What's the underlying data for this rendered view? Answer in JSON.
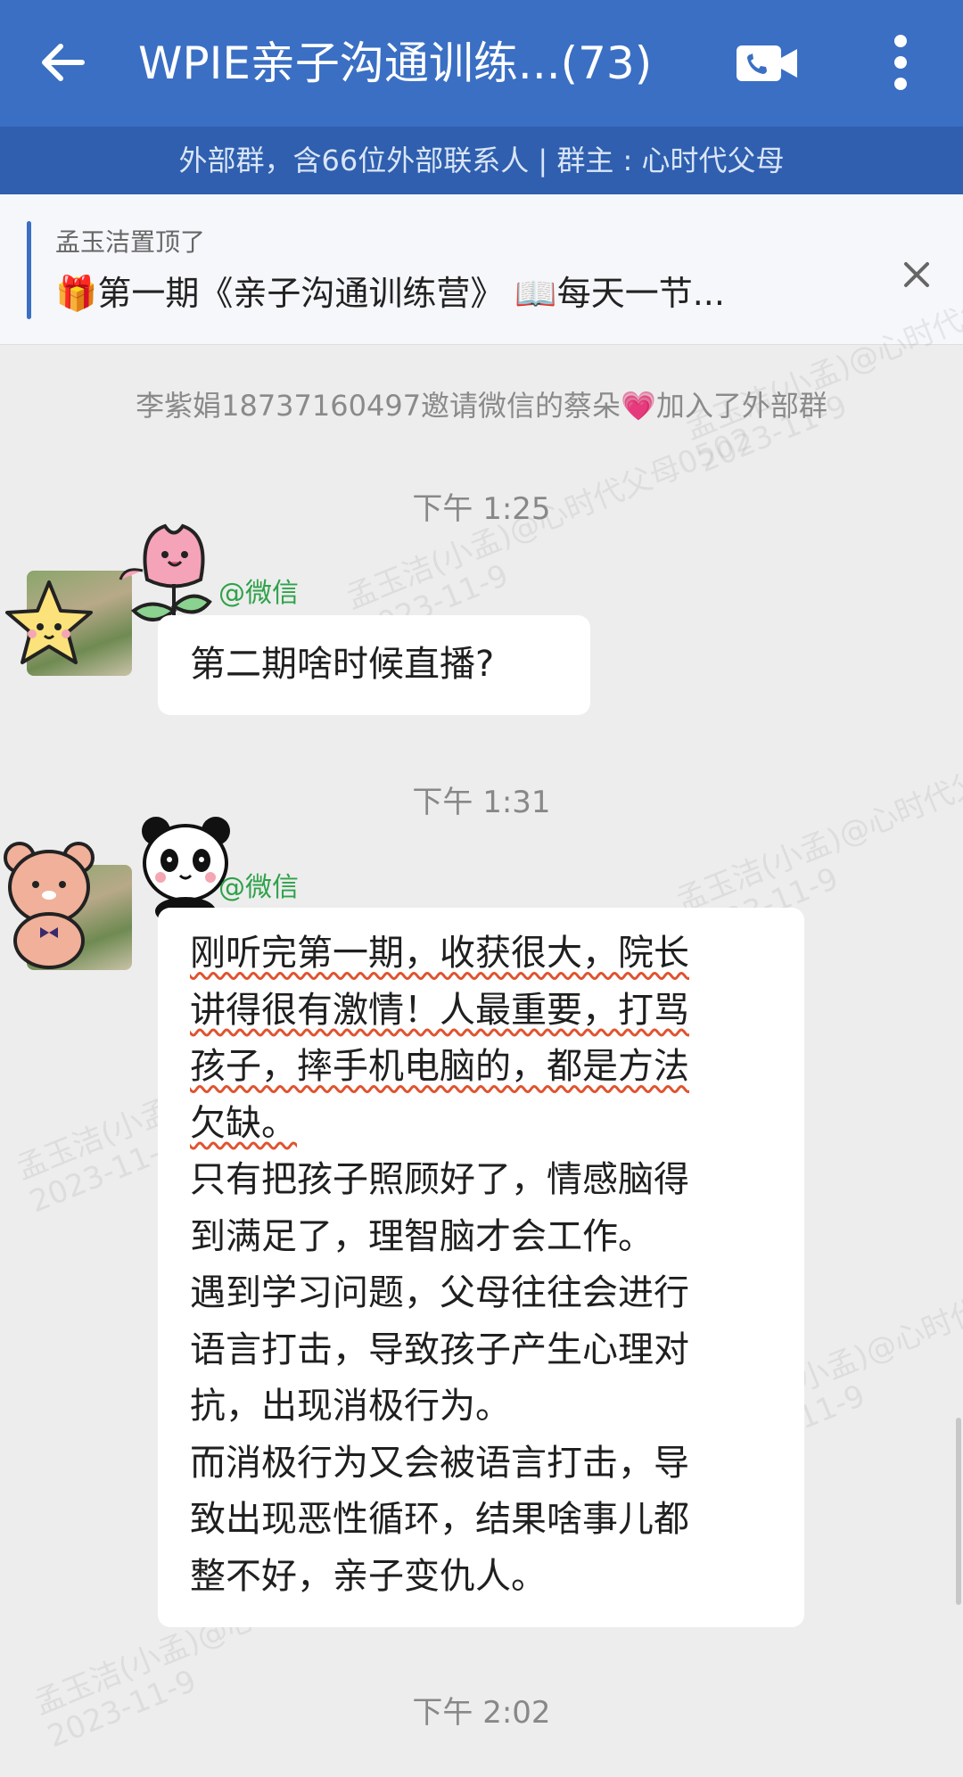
{
  "header": {
    "title": "WPIE亲子沟通训练...(73)",
    "subtitle": "外部群，含66位外部联系人 | 群主 : 心时代父母"
  },
  "pinned": {
    "by": "孟玉洁置顶了",
    "content": "🎁第一期《亲子沟通训练营》 📖每天一节..."
  },
  "messages": {
    "system": "李紫娟18737160497邀请微信的蔡朵💗加入了外部群",
    "time1": "下午 1:25",
    "msg1_sender": "@微信",
    "msg1_text": "第二期啥时候直播?",
    "time2": "下午 1:31",
    "msg2_sender": "@微信",
    "msg2_lines": [
      "刚听完第一期，收获很大，院长",
      "讲得很有激情！人最重要，打骂",
      "孩子，摔手机电脑的，都是方法",
      "欠缺。",
      "只有把孩子照顾好了，情感脑得",
      "到满足了，理智脑才会工作。",
      "遇到学习问题，父母往往会进行",
      "语言打击，导致孩子产生心理对",
      "抗，出现消极行为。",
      "而消极行为又会被语言打击，导",
      "致出现恶性循环，结果啥事儿都",
      "整不好，亲子变仇人。"
    ],
    "time3": "下午 2:02"
  },
  "watermarks": [
    "孟玉洁(小孟)@心时代父母0502",
    "2023-11-9"
  ],
  "icons": {
    "back": "arrow-left-icon",
    "call": "video-call-icon",
    "more": "more-vertical-icon",
    "close": "close-icon"
  },
  "colors": {
    "header_bg": "#3a6fc4",
    "subbar_bg": "#2f5fae",
    "sender_green": "#2fa24a",
    "underline": "#e0532f"
  }
}
